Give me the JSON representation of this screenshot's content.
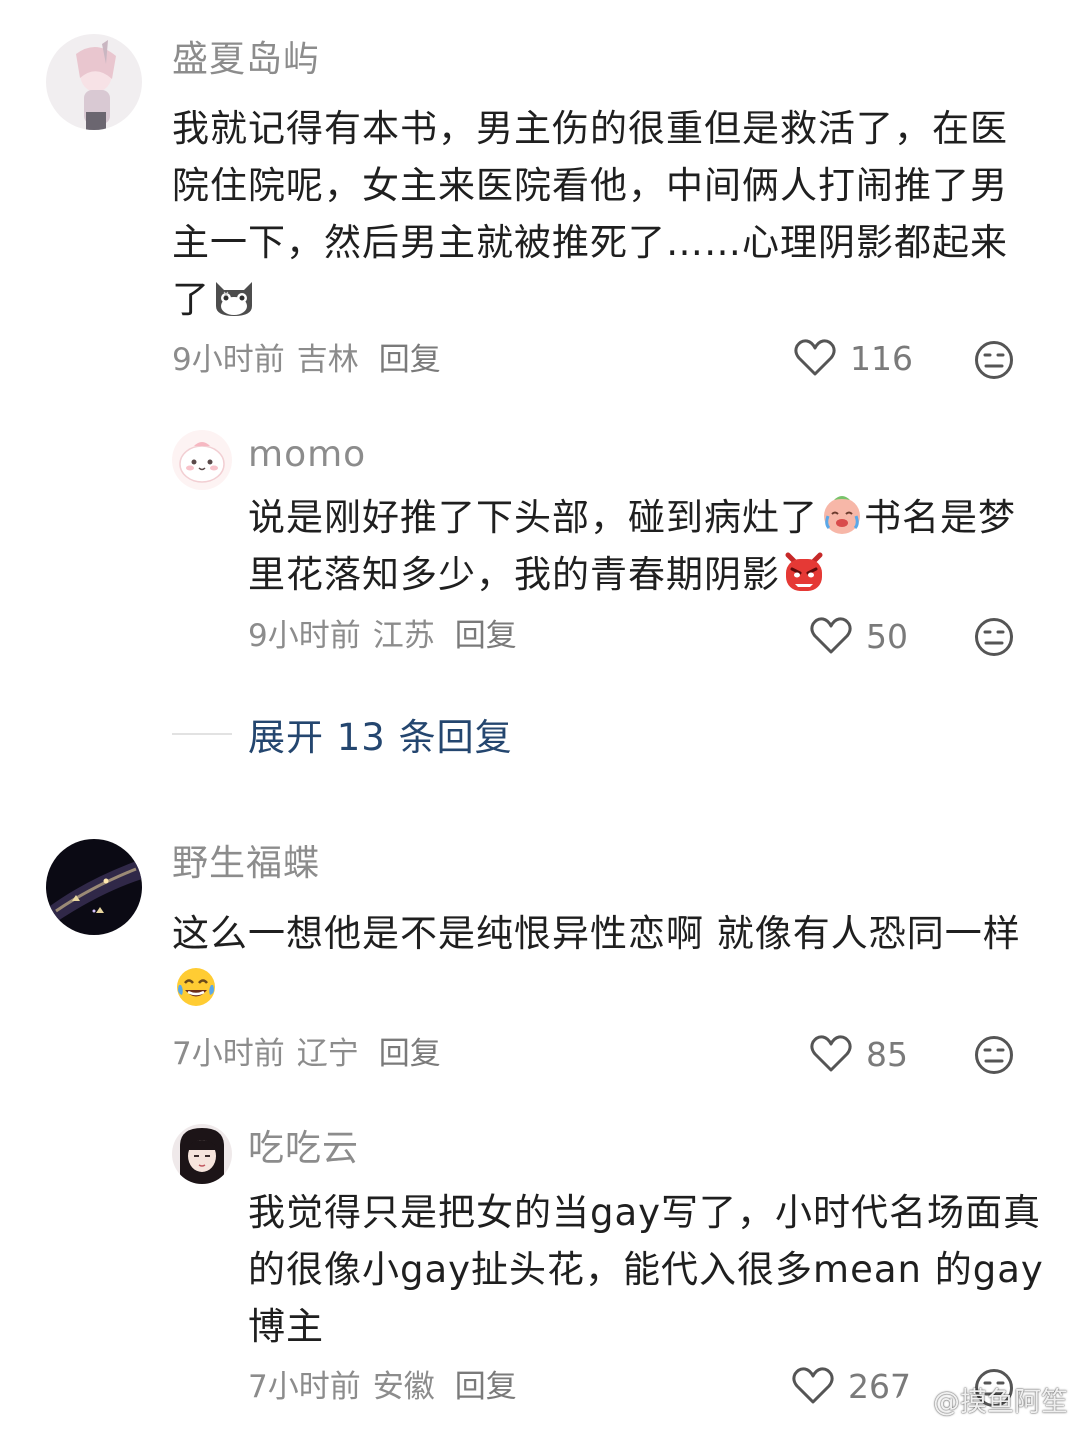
{
  "comments": [
    {
      "user": "盛夏岛屿",
      "text": "我就记得有本书，男主伤的很重但是救活了，在医院住院呢，女主来医院看他，中间俩人打闹推了男主一下，然后男主就被推死了……心理阴影都起来了",
      "emoji": "cat-emoji",
      "time": "9小时前",
      "location": "吉林",
      "reply_label": "回复",
      "likes": "116",
      "replies": [
        {
          "user": "momo",
          "text_part1": "说是刚好推了下头部，碰到病灶了",
          "emoji1": "crying-face-emoji",
          "text_part2": "书名是梦里花落知多少，我的青春期阴影",
          "emoji2": "angry-devil-emoji",
          "time": "9小时前",
          "location": "江苏",
          "reply_label": "回复",
          "likes": "50"
        }
      ],
      "expand_label": "展开 13 条回复"
    },
    {
      "user": "野生福蝶",
      "text": "这么一想他是不是纯恨异性恋啊 就像有人恐同一样",
      "emoji": "tears-of-joy-emoji",
      "time": "7小时前",
      "location": "辽宁",
      "reply_label": "回复",
      "likes": "85",
      "replies": [
        {
          "user": "吃吃云",
          "text": "我觉得只是把女的当gay写了，小时代名场面真的很像小gay扯头花，能代入很多mean 的gay博主",
          "time": "7小时前",
          "location": "安徽",
          "reply_label": "回复",
          "likes": "267"
        }
      ]
    }
  ],
  "watermark": "@摸鱼阿笙",
  "colors": {
    "username": "#8c8c8c",
    "meta": "#8c8c8c",
    "expand_link": "#24466f",
    "text": "#1f1f1f"
  }
}
